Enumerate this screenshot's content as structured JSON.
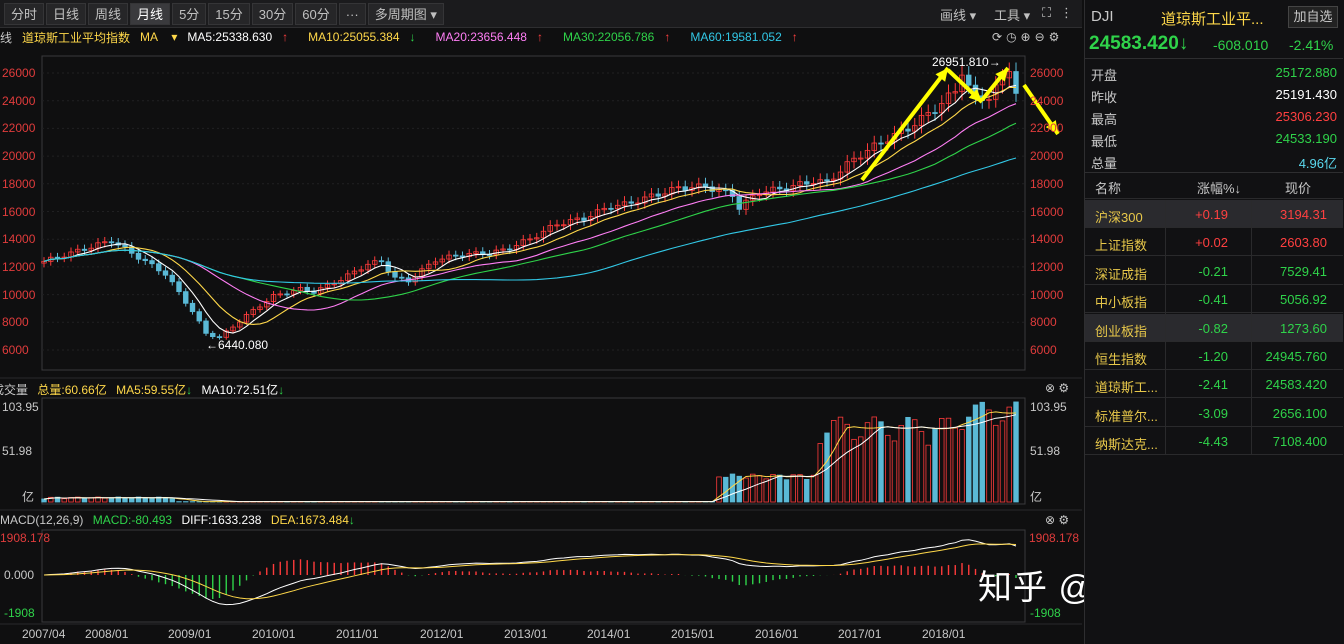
{
  "toolbar": {
    "periods": [
      "分时",
      "日线",
      "周线",
      "月线",
      "5分",
      "15分",
      "30分",
      "60分",
      "···",
      "多周期图"
    ],
    "active_period": "月线",
    "draw_line": "画线",
    "tools": "工具"
  },
  "legend": {
    "prefix": "线",
    "index_name": "道琼斯工业平均指数",
    "indicator": "MA",
    "ma5": "MA5:25338.630",
    "ma10": "MA10:25055.384",
    "ma20": "MA20:23656.448",
    "ma30": "MA30:22056.786",
    "ma60": "MA60:19581.052"
  },
  "main_chart": {
    "y_ticks": [
      "26000",
      "24000",
      "22000",
      "20000",
      "18000",
      "16000",
      "14000",
      "12000",
      "10000",
      "8000",
      "6000"
    ],
    "high_label": "26951.810→",
    "low_label": "←6440.080",
    "colors": {
      "up": "#ff3b3b",
      "down": "#5ab9d6",
      "ma5": "#ffffff",
      "ma10": "#ffd84a",
      "ma20": "#ff7ef5",
      "ma30": "#2fd34a",
      "ma60": "#32c8e6"
    }
  },
  "volume": {
    "title": "成交量",
    "total": "总量:60.66亿",
    "ma5": "MA5:59.55亿",
    "ma10": "MA10:72.51亿",
    "y_top": "103.95",
    "y_mid": "51.98",
    "y_unit": "亿"
  },
  "macd": {
    "title": "MACD(12,26,9)",
    "macd": "MACD:-80.493",
    "diff": "DIFF:1633.238",
    "dea": "DEA:1673.484",
    "y_top": "1908.178",
    "y_mid": "0.000",
    "y_bot": "-1908"
  },
  "x_labels": [
    "2007/04",
    "2008/01",
    "2009/01",
    "2010/01",
    "2011/01",
    "2012/01",
    "2013/01",
    "2014/01",
    "2015/01",
    "2016/01",
    "2017/01",
    "2018/01"
  ],
  "watermark": "知乎 @华科笑笑生",
  "quote": {
    "symbol": "DJI",
    "name": "道琼斯工业平...",
    "add_button": "加自选",
    "price": "24583.420",
    "change": "-608.010",
    "change_pct": "-2.41%",
    "rows": [
      {
        "k": "开盘",
        "v": "25172.880",
        "color": "#2fd34a"
      },
      {
        "k": "昨收",
        "v": "25191.430",
        "color": "#ffffff"
      },
      {
        "k": "最高",
        "v": "25306.230",
        "color": "#ff4040"
      },
      {
        "k": "最低",
        "v": "24533.190",
        "color": "#2fd34a"
      },
      {
        "k": "总量",
        "v": "4.96亿",
        "color": "#5ad8ee"
      }
    ]
  },
  "market_table": {
    "headers": [
      "名称",
      "涨幅%↓",
      "现价"
    ],
    "rows": [
      {
        "name": "沪深300",
        "chg": "+0.19",
        "price": "3194.31",
        "up": true
      },
      {
        "name": "上证指数",
        "chg": "+0.02",
        "price": "2603.80",
        "up": true
      },
      {
        "name": "深证成指",
        "chg": "-0.21",
        "price": "7529.41",
        "up": false
      },
      {
        "name": "中小板指",
        "chg": "-0.41",
        "price": "5056.92",
        "up": false
      },
      {
        "name": "创业板指",
        "chg": "-0.82",
        "price": "1273.60",
        "up": false
      },
      {
        "name": "恒生指数",
        "chg": "-1.20",
        "price": "24945.760",
        "up": false
      },
      {
        "name": "道琼斯工...",
        "chg": "-2.41",
        "price": "24583.420",
        "up": false
      },
      {
        "name": "标准普尔...",
        "chg": "-3.09",
        "price": "2656.100",
        "up": false
      },
      {
        "name": "纳斯达克...",
        "chg": "-4.43",
        "price": "7108.400",
        "up": false
      }
    ]
  }
}
